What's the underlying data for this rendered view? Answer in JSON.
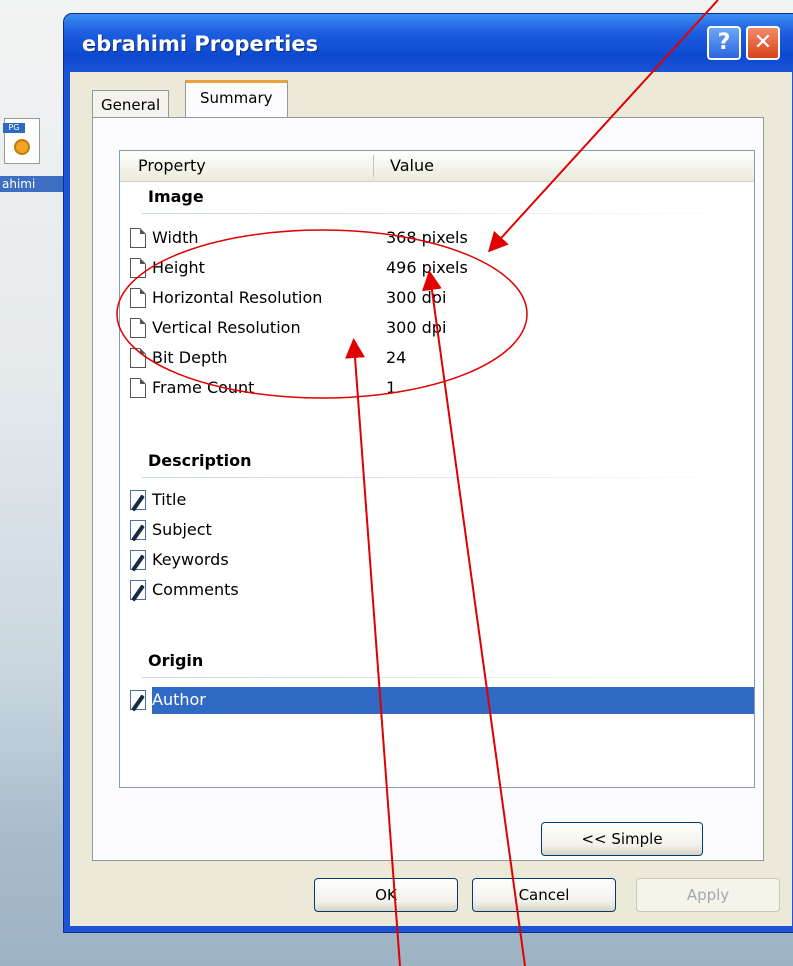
{
  "desktop": {
    "icon_label": "ahimi",
    "icon_tag": "PG"
  },
  "dialog": {
    "title": "ebrahimi Properties",
    "help_label": "?",
    "close_label": "✕"
  },
  "tabs": [
    {
      "label": "General",
      "active": false
    },
    {
      "label": "Summary",
      "active": true
    }
  ],
  "list": {
    "headers": {
      "property": "Property",
      "value": "Value"
    },
    "groups": [
      {
        "title": "Image",
        "rows": [
          {
            "name": "Width",
            "value": "368 pixels",
            "icon": "document-icon"
          },
          {
            "name": "Height",
            "value": "496 pixels",
            "icon": "document-icon"
          },
          {
            "name": "Horizontal Resolution",
            "value": "300 dpi",
            "icon": "document-icon"
          },
          {
            "name": "Vertical Resolution",
            "value": "300 dpi",
            "icon": "document-icon"
          },
          {
            "name": "Bit Depth",
            "value": "24",
            "icon": "document-icon"
          },
          {
            "name": "Frame Count",
            "value": "1",
            "icon": "document-icon"
          }
        ]
      },
      {
        "title": "Description",
        "rows": [
          {
            "name": "Title",
            "value": "",
            "icon": "edit-icon"
          },
          {
            "name": "Subject",
            "value": "",
            "icon": "edit-icon"
          },
          {
            "name": "Keywords",
            "value": "",
            "icon": "edit-icon"
          },
          {
            "name": "Comments",
            "value": "",
            "icon": "edit-icon"
          }
        ]
      },
      {
        "title": "Origin",
        "rows": [
          {
            "name": "Author",
            "value": "",
            "icon": "edit-icon",
            "selected": true
          }
        ]
      }
    ]
  },
  "buttons": {
    "simple": "<< Simple",
    "ok": "OK",
    "cancel": "Cancel",
    "apply": "Apply"
  },
  "colors": {
    "annotation": "#e00000",
    "selection": "#316ac5",
    "titlebar": "#0c49d1"
  }
}
